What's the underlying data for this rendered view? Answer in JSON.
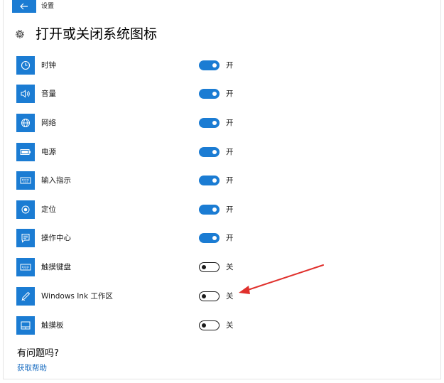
{
  "window": {
    "title": "设置",
    "back_icon": "arrow-left-icon"
  },
  "page": {
    "title": "打开或关闭系统图标",
    "icon": "gear-icon"
  },
  "items": [
    {
      "label": "时钟",
      "state": "开",
      "on": true,
      "icon": "clock-icon"
    },
    {
      "label": "音量",
      "state": "开",
      "on": true,
      "icon": "volume-icon"
    },
    {
      "label": "网络",
      "state": "开",
      "on": true,
      "icon": "globe-icon"
    },
    {
      "label": "电源",
      "state": "开",
      "on": true,
      "icon": "battery-icon"
    },
    {
      "label": "输入指示",
      "state": "开",
      "on": true,
      "icon": "keyboard-icon"
    },
    {
      "label": "定位",
      "state": "开",
      "on": true,
      "icon": "location-icon"
    },
    {
      "label": "操作中心",
      "state": "开",
      "on": true,
      "icon": "action-center-icon"
    },
    {
      "label": "触摸键盘",
      "state": "关",
      "on": false,
      "icon": "touch-keyboard-icon"
    },
    {
      "label": "Windows Ink 工作区",
      "state": "关",
      "on": false,
      "icon": "pen-icon"
    },
    {
      "label": "触摸板",
      "state": "关",
      "on": false,
      "icon": "touchpad-icon"
    }
  ],
  "help": {
    "title": "有问题吗?",
    "link": "获取帮助"
  },
  "colors": {
    "accent": "#1b7cd3",
    "annotation_arrow": "#e0302c"
  }
}
